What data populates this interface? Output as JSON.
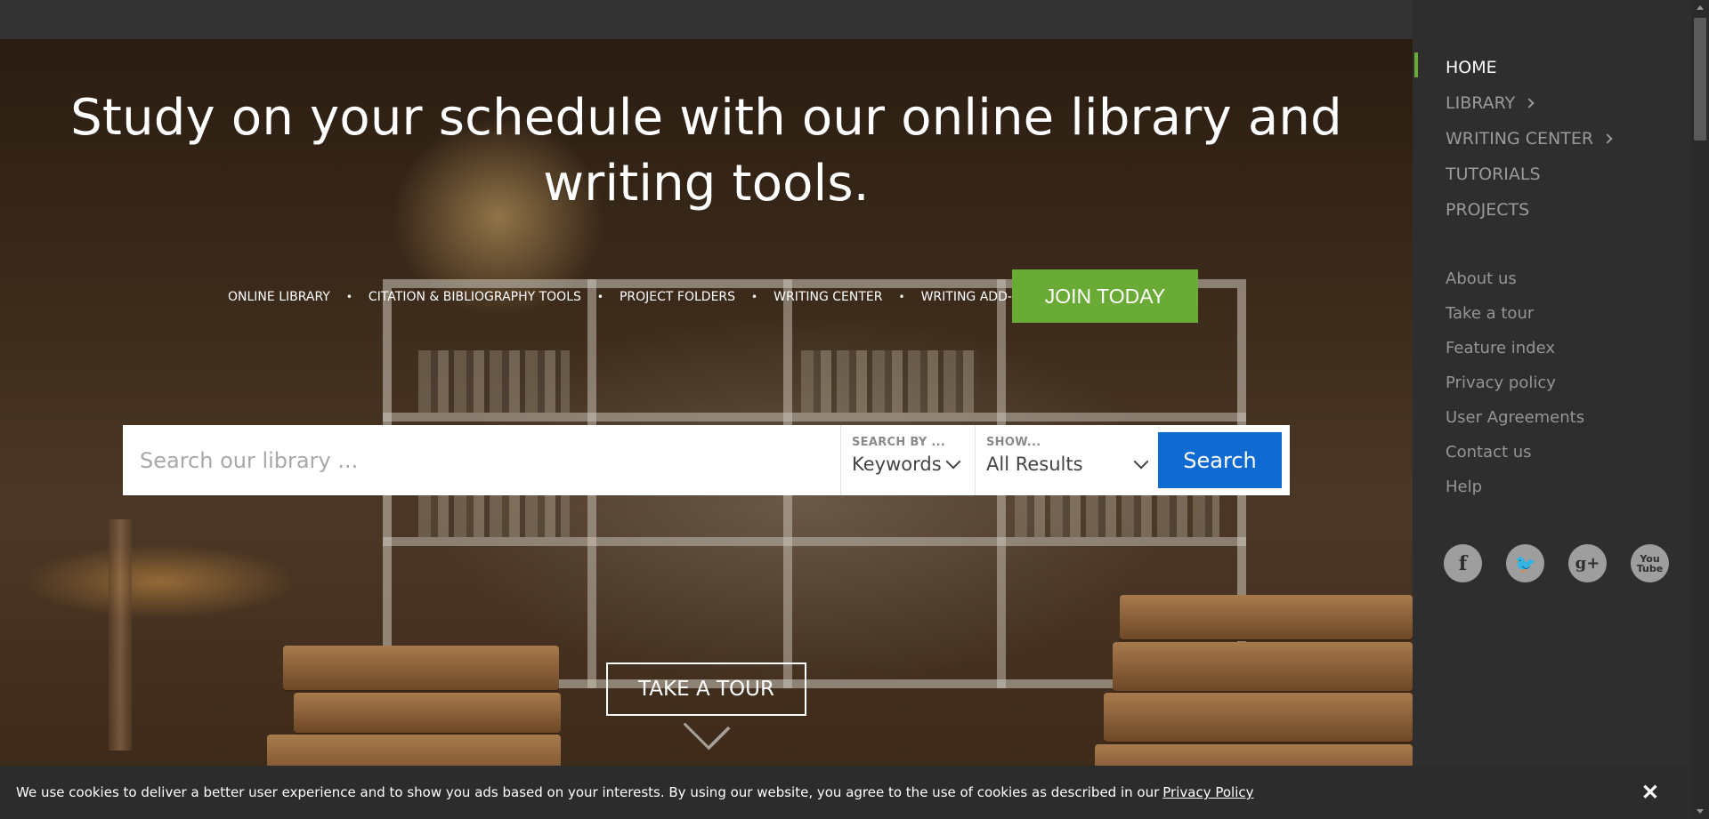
{
  "hero": {
    "title": "Study on your schedule with our online library and writing tools.",
    "features": [
      "ONLINE LIBRARY",
      "CITATION & BIBLIOGRAPHY TOOLS",
      "PROJECT FOLDERS",
      "WRITING CENTER",
      "WRITING ADD-IN"
    ],
    "separator": "•",
    "join_label": "JOIN TODAY",
    "tour_label": "TAKE A TOUR"
  },
  "search": {
    "placeholder": "Search our library ...",
    "search_by_label": "SEARCH BY ...",
    "search_by_value": "Keywords",
    "show_label": "SHOW...",
    "show_value": "All Results",
    "button_label": "Search"
  },
  "sidebar": {
    "nav": [
      {
        "label": "HOME",
        "active": true,
        "has_submenu": false
      },
      {
        "label": "LIBRARY",
        "active": false,
        "has_submenu": true
      },
      {
        "label": "WRITING CENTER",
        "active": false,
        "has_submenu": true
      },
      {
        "label": "TUTORIALS",
        "active": false,
        "has_submenu": false
      },
      {
        "label": "PROJECTS",
        "active": false,
        "has_submenu": false
      }
    ],
    "links": [
      "About us",
      "Take a tour",
      "Feature index",
      "Privacy policy",
      "User Agreements",
      "Contact us",
      "Help"
    ],
    "socials": [
      {
        "icon": "facebook-icon",
        "glyph": "f"
      },
      {
        "icon": "twitter-icon",
        "glyph": "🐦"
      },
      {
        "icon": "google-plus-icon",
        "glyph": "g+"
      },
      {
        "icon": "youtube-icon",
        "glyph": "You Tube"
      }
    ]
  },
  "cookie": {
    "text": "We use cookies to deliver a better user experience and to show you ads based on your interests. By using our website, you agree to the use of cookies as described in our",
    "link": "Privacy Policy",
    "close": "✕"
  },
  "colors": {
    "accent_green": "#6aab35",
    "search_blue": "#0f6ad1",
    "sidebar_bg": "#2e2e2e"
  }
}
